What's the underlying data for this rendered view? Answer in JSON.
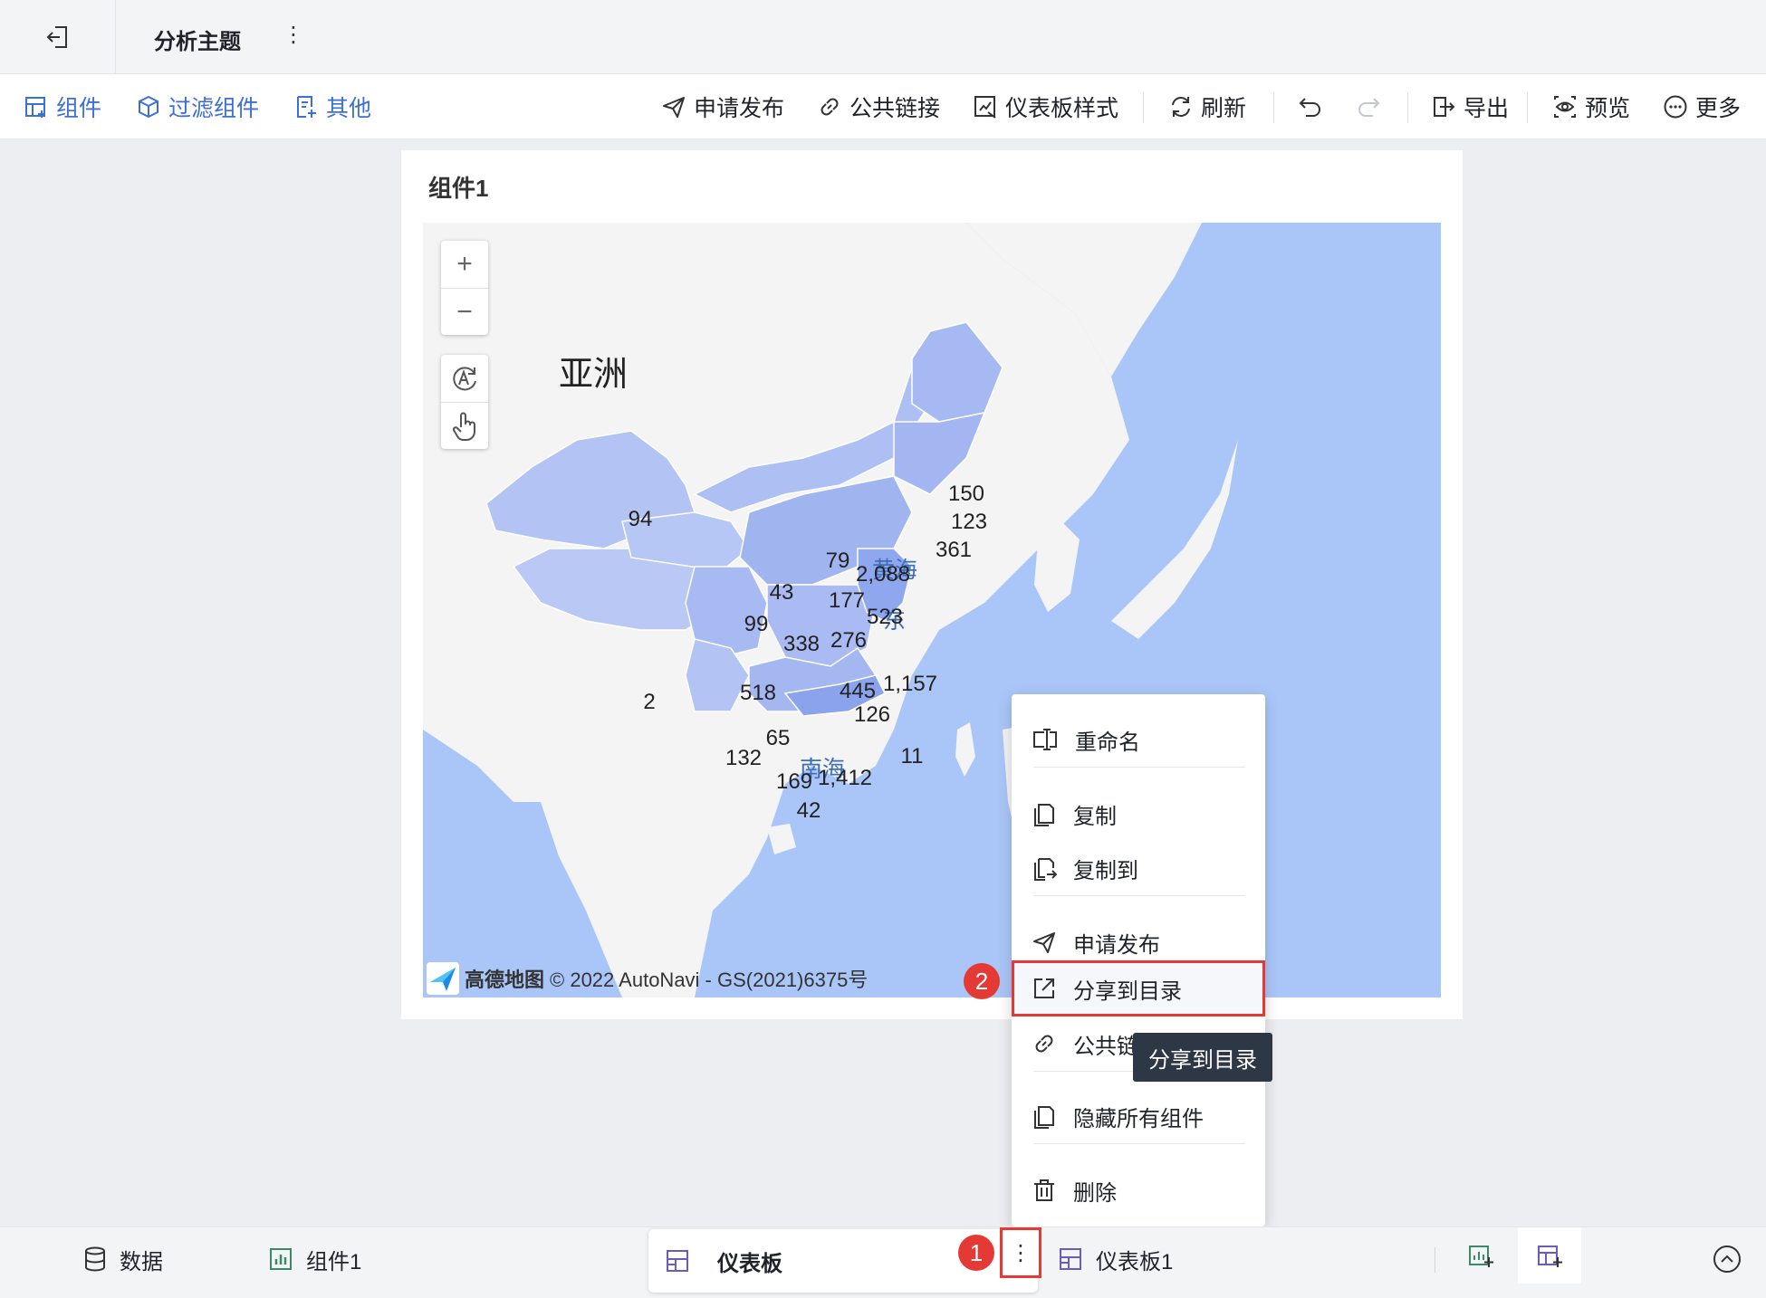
{
  "header": {
    "title": "分析主题",
    "more_icon": "⋮"
  },
  "toolbar": {
    "left": [
      {
        "label": "组件",
        "icon": "add-component-icon"
      },
      {
        "label": "过滤组件",
        "icon": "filter-component-icon"
      },
      {
        "label": "其他",
        "icon": "other-icon"
      }
    ],
    "right": [
      {
        "label": "申请发布",
        "icon": "send-icon"
      },
      {
        "label": "公共链接",
        "icon": "link-icon"
      },
      {
        "label": "仪表板样式",
        "icon": "dashboard-style-icon"
      },
      {
        "label": "刷新",
        "icon": "refresh-icon"
      },
      {
        "label": "导出",
        "icon": "export-icon"
      },
      {
        "label": "预览",
        "icon": "preview-icon"
      },
      {
        "label": "更多",
        "icon": "more-circle-icon"
      }
    ]
  },
  "card": {
    "title": "组件1"
  },
  "map": {
    "continent_label": "亚洲",
    "sea_labels": [
      "黄海",
      "东",
      "南海"
    ],
    "attribution_brand": "高德地图",
    "attribution_text": "© 2022 AutoNavi - GS(2021)6375号",
    "zoom_in": "+",
    "zoom_out": "−",
    "province_values": [
      {
        "label": "94"
      },
      {
        "label": "150"
      },
      {
        "label": "123"
      },
      {
        "label": "361"
      },
      {
        "label": "79"
      },
      {
        "label": "2,088"
      },
      {
        "label": "43"
      },
      {
        "label": "177"
      },
      {
        "label": "523"
      },
      {
        "label": "99"
      },
      {
        "label": "338"
      },
      {
        "label": "276"
      },
      {
        "label": "1,157"
      },
      {
        "label": "518"
      },
      {
        "label": "445"
      },
      {
        "label": "2"
      },
      {
        "label": "126"
      },
      {
        "label": "65"
      },
      {
        "label": "132"
      },
      {
        "label": "169"
      },
      {
        "label": "1,412"
      },
      {
        "label": "11"
      },
      {
        "label": "42"
      }
    ]
  },
  "context_menu": {
    "items": [
      {
        "label": "重命名",
        "icon": "rename-icon"
      },
      {
        "label": "复制",
        "icon": "copy-icon"
      },
      {
        "label": "复制到",
        "icon": "copy-to-icon"
      },
      {
        "label": "申请发布",
        "icon": "send-icon"
      },
      {
        "label": "分享到目录",
        "icon": "share-icon"
      },
      {
        "label": "公共链接",
        "icon": "link-icon"
      },
      {
        "label": "隐藏所有组件",
        "icon": "hide-components-icon"
      },
      {
        "label": "删除",
        "icon": "trash-icon"
      }
    ]
  },
  "tooltip": "分享到目录",
  "steps": [
    "1",
    "2"
  ],
  "tabs": [
    {
      "label": "数据",
      "icon": "database-icon"
    },
    {
      "label": "组件1",
      "icon": "bar-chart-icon"
    },
    {
      "label": "仪表板",
      "icon": "dashboard-grid-icon"
    },
    {
      "label": "仪表板1",
      "icon": "dashboard-grid-icon"
    }
  ],
  "colors": {
    "accent_blue": "#3b6fd9",
    "highlight_red": "#e53935",
    "sea": "#aac6f8",
    "land": "#f4f4f4",
    "province_fill": "#b9c8f5"
  }
}
